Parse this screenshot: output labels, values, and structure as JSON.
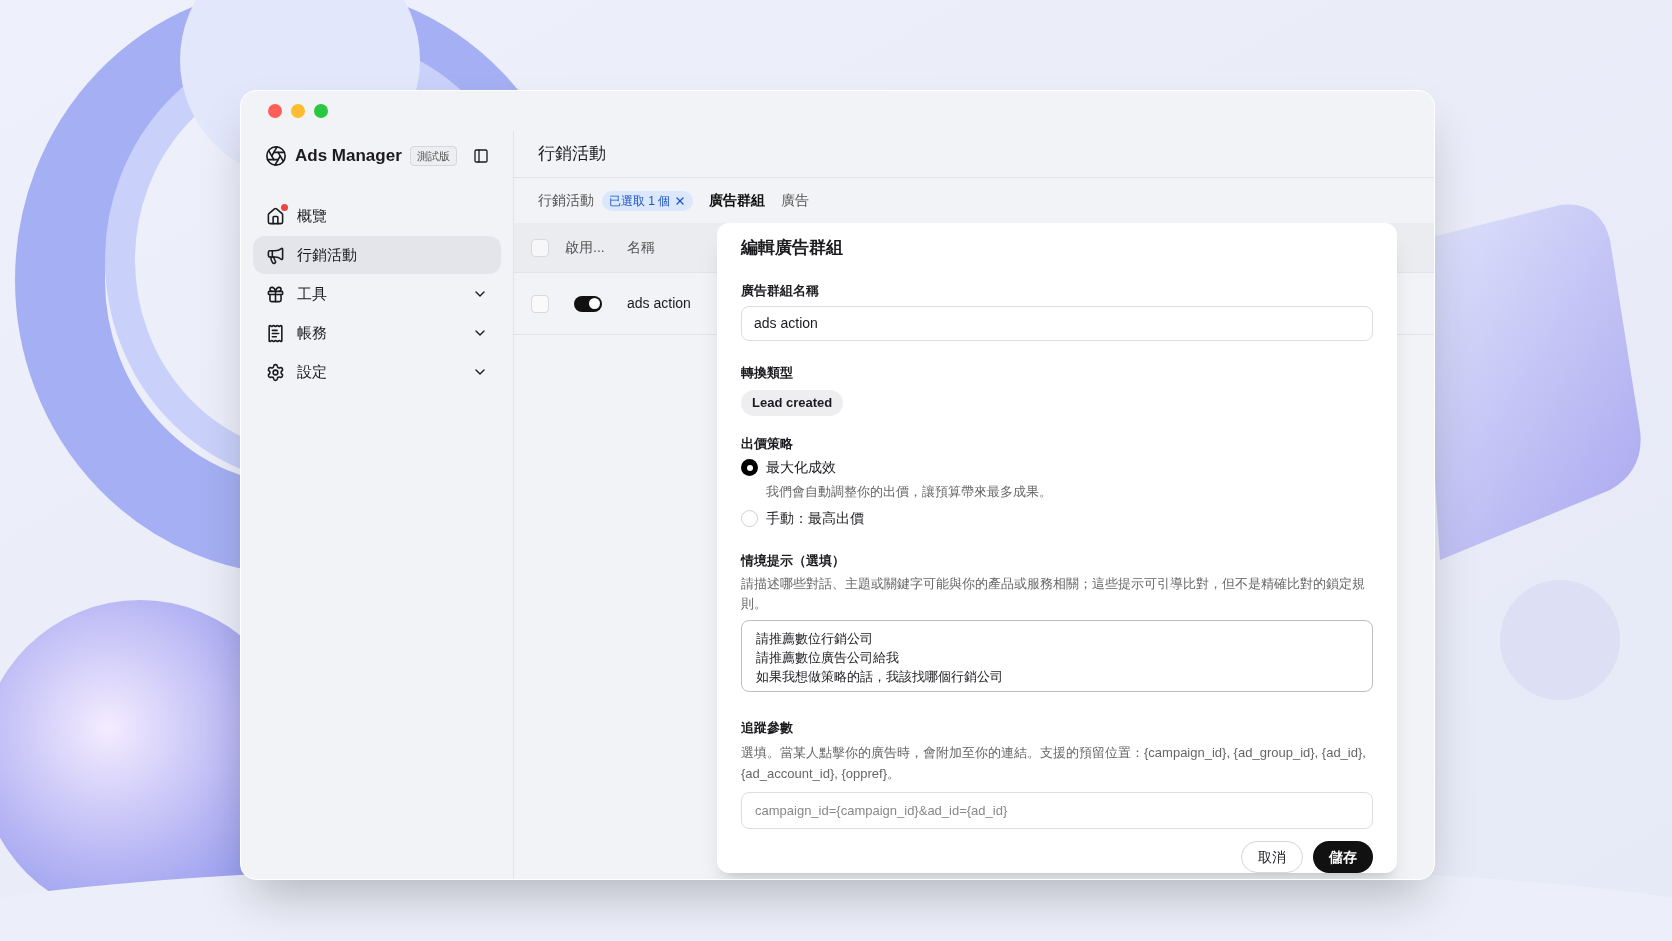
{
  "sidebar": {
    "app_name": "Ads Manager",
    "badge": "測試版",
    "items": [
      {
        "label": "概覽",
        "selected": false,
        "notification": true,
        "has_submenu": false
      },
      {
        "label": "行銷活動",
        "selected": true,
        "notification": false,
        "has_submenu": false
      },
      {
        "label": "工具",
        "selected": false,
        "notification": false,
        "has_submenu": true
      },
      {
        "label": "帳務",
        "selected": false,
        "notification": false,
        "has_submenu": true
      },
      {
        "label": "設定",
        "selected": false,
        "notification": false,
        "has_submenu": true
      }
    ]
  },
  "main": {
    "title": "行銷活動",
    "tabs": [
      {
        "label": "行銷活動",
        "selected": false,
        "filter_chip": "已選取 1 個"
      },
      {
        "label": "廣告群組",
        "selected": true
      },
      {
        "label": "廣告",
        "selected": false
      }
    ],
    "table": {
      "select_all_checked": false,
      "columns": [
        "啟用...",
        "名稱"
      ],
      "rows": [
        {
          "checked": false,
          "enabled": true,
          "name": "ads action"
        }
      ]
    }
  },
  "dialog": {
    "title": "編輯廣告群組",
    "name_field": {
      "label": "廣告群組名稱",
      "value": "ads action"
    },
    "conversion": {
      "label": "轉換類型",
      "chip": "Lead created"
    },
    "bidding": {
      "label": "出價策略",
      "options": [
        {
          "label": "最大化成效",
          "selected": true,
          "description": "我們會自動調整你的出價，讓預算帶來最多成果。"
        },
        {
          "label": "手動：最高出價",
          "selected": false
        }
      ]
    },
    "context": {
      "label": "情境提示（選填）",
      "description": "請描述哪些對話、主題或關鍵字可能與你的產品或服務相關；這些提示可引導比對，但不是精確比對的鎖定規則。",
      "lines": [
        "請推薦數位行銷公司",
        "請推薦數位廣告公司給我",
        "如果我想做策略的話，我該找哪個行銷公司"
      ]
    },
    "tracking": {
      "label": "追蹤參數",
      "description": "選填。當某人點擊你的廣告時，會附加至你的連結。支援的預留位置：{campaign_id}, {ad_group_id}, {ad_id}, {ad_account_id}, {oppref}。",
      "placeholder": "campaign_id={campaign_id}&ad_id={ad_id}"
    },
    "buttons": [
      {
        "label": "取消",
        "kind": "secondary"
      },
      {
        "label": "儲存",
        "kind": "primary"
      }
    ]
  }
}
